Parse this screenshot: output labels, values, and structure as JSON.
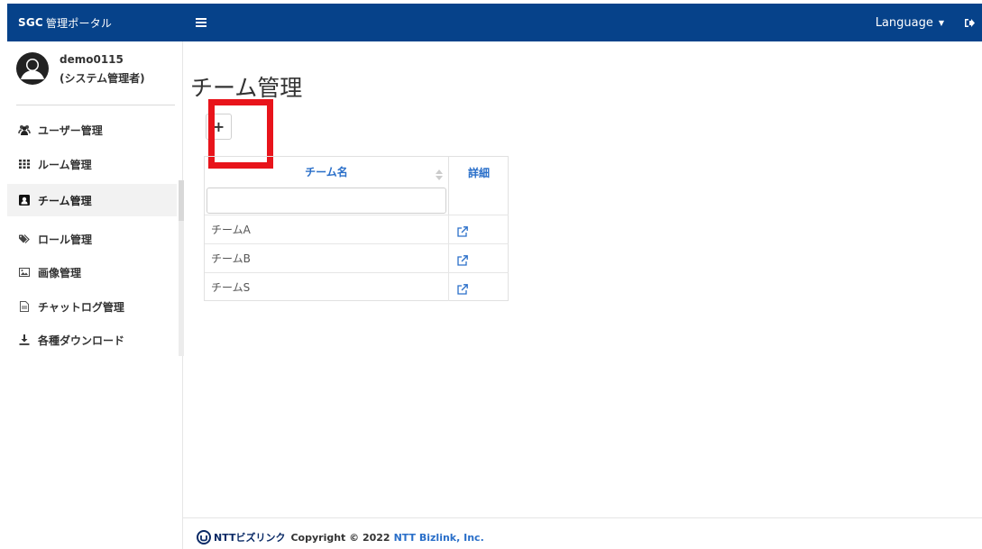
{
  "app": {
    "brand_bold": "SGC",
    "brand_rest": "管理ポータル",
    "language_label": "Language"
  },
  "user": {
    "name": "demo0115",
    "role": "(システム管理者)"
  },
  "sidebar": {
    "items": [
      {
        "label": "ユーザー管理",
        "icon": "users-icon"
      },
      {
        "label": "ルーム管理",
        "icon": "grid-icon"
      },
      {
        "label": "チーム管理",
        "icon": "team-icon",
        "active": true
      },
      {
        "label": "ロール管理",
        "icon": "tag-icon"
      },
      {
        "label": "画像管理",
        "icon": "image-icon"
      },
      {
        "label": "チャットログ管理",
        "icon": "file-icon"
      },
      {
        "label": "各種ダウンロード",
        "icon": "download-icon"
      }
    ]
  },
  "main": {
    "title": "チーム管理",
    "add_label": "+",
    "table": {
      "col_name": "チーム名",
      "col_detail": "詳細",
      "filter_value": "",
      "rows": [
        {
          "name": "チームA"
        },
        {
          "name": "チームB"
        },
        {
          "name": "チームS"
        }
      ]
    }
  },
  "footer": {
    "logo_text": "NTTビズリンク",
    "copyright": "Copyright © 2022",
    "company": "NTT Bizlink, Inc."
  },
  "colors": {
    "topbar": "#06428a",
    "link": "#2a6fc9",
    "highlight": "#e8141b"
  }
}
